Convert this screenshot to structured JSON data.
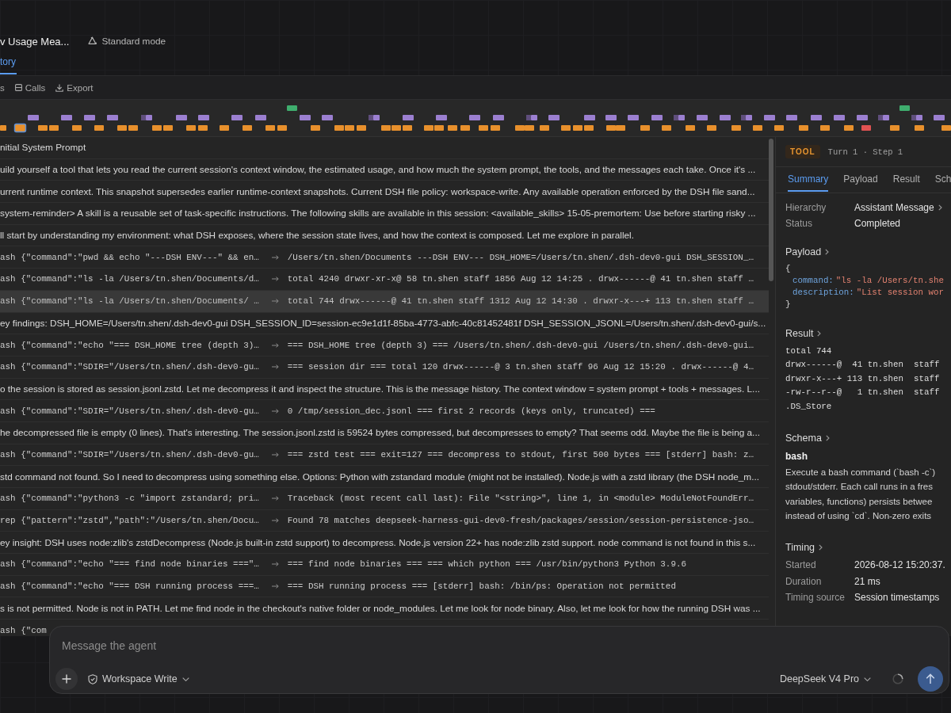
{
  "header": {
    "title": "v Usage Mea...",
    "mode": "Standard mode",
    "tabs": [
      {
        "label": "tory",
        "selected": true
      }
    ]
  },
  "toolbar": {
    "item_1": "s",
    "calls_button": "Calls",
    "export_button": "Export"
  },
  "rows": [
    {
      "kind": "text",
      "text": "nitial System Prompt",
      "selected": false
    },
    {
      "kind": "text",
      "text": "uild yourself a tool that lets you read the current session's context window, the estimated usage, and how much the system prompt, the tools, and the messages each take. Once it's ...",
      "selected": false
    },
    {
      "kind": "text",
      "text": "urrent runtime context. This snapshot supersedes earlier runtime-context snapshots. Current DSH file policy: workspace-write. Any available operation enforced by the DSH file sand...",
      "selected": false
    },
    {
      "kind": "text",
      "text": "system-reminder> A skill is a reusable set of task-specific instructions. The following skills are available in this session: <available_skills> 15-05-premortem: Use before starting risky ...",
      "selected": false
    },
    {
      "kind": "text",
      "text": "ll start by understanding my environment: what DSH exposes, where the session state lives, and how the context is composed. Let me explore in parallel.",
      "selected": false
    },
    {
      "kind": "tool",
      "command": "ash {\"command\":\"pwd && echo \"---DSH ENV---\" && en…",
      "result": "/Users/tn.shen/Documents ---DSH ENV--- DSH_HOME=/Users/tn.shen/.dsh-dev0-gui DSH_SESSION_…",
      "selected": false
    },
    {
      "kind": "tool",
      "command": "ash {\"command\":\"ls -la /Users/tn.shen/Documents/d…",
      "result": "total 4240 drwxr-xr-x@ 58 tn.shen staff 1856 Aug 12 14:25 . drwx------@ 41 tn.shen staff …",
      "selected": false
    },
    {
      "kind": "tool",
      "command": "ash {\"command\":\"ls -la /Users/tn.shen/Documents/ …",
      "result": "total 744 drwx------@ 41 tn.shen staff 1312 Aug 12 14:30 . drwxr-x---+ 113 tn.shen staff …",
      "selected": true
    },
    {
      "kind": "text",
      "text": "ey findings: DSH_HOME=/Users/tn.shen/.dsh-dev0-gui DSH_SESSION_ID=session-ec9e1d1f-85ba-4773-abfc-40c81452481f DSH_SESSION_JSONL=/Users/tn.shen/.dsh-dev0-gui/s...",
      "selected": false
    },
    {
      "kind": "tool",
      "command": "ash {\"command\":\"echo \"=== DSH_HOME tree (depth 3)…",
      "result": "=== DSH_HOME tree (depth 3) === /Users/tn.shen/.dsh-dev0-gui /Users/tn.shen/.dsh-dev0-gui…",
      "selected": false
    },
    {
      "kind": "tool",
      "command": "ash {\"command\":\"SDIR=\"/Users/tn.shen/.dsh-dev0-gu…",
      "result": "=== session dir === total 120 drwx------@ 3 tn.shen staff 96 Aug 12 15:20 . drwx------@ 4…",
      "selected": false
    },
    {
      "kind": "text",
      "text": "o the session is stored as session.jsonl.zstd. Let me decompress it and inspect the structure. This is the message history. The context window = system prompt + tools + messages. L...",
      "selected": false
    },
    {
      "kind": "tool",
      "command": "ash {\"command\":\"SDIR=\"/Users/tn.shen/.dsh-dev0-gu…",
      "result": "0 /tmp/session_dec.jsonl === first 2 records (keys only, truncated) ===",
      "selected": false
    },
    {
      "kind": "text",
      "text": "he decompressed file is empty (0 lines). That's interesting. The session.jsonl.zstd is 59524 bytes compressed, but decompresses to empty? That seems odd. Maybe the file is being a...",
      "selected": false
    },
    {
      "kind": "tool",
      "command": "ash {\"command\":\"SDIR=\"/Users/tn.shen/.dsh-dev0-gu…",
      "result": "=== zstd test === exit=127 === decompress to stdout, first 500 bytes === [stderr] bash: z…",
      "selected": false
    },
    {
      "kind": "text",
      "text": "std command not found. So I need to decompress using something else. Options: Python with zstandard module (might not be installed). Node.js with a zstd library (the DSH node_m...",
      "selected": false
    },
    {
      "kind": "tool",
      "command": "ash {\"command\":\"python3 -c \"import zstandard; pri…",
      "result": "Traceback (most recent call last): File \"<string>\", line 1, in <module> ModuleNotFoundErr…",
      "selected": false
    },
    {
      "kind": "tool",
      "command": "rep {\"pattern\":\"zstd\",\"path\":\"/Users/tn.shen/Docu…",
      "result": "Found 78 matches deepseek-harness-gui-dev0-fresh/packages/session/session-persistence-jso…",
      "selected": false
    },
    {
      "kind": "text",
      "text": "ey insight: DSH uses node:zlib's zstdDecompress (Node.js built-in zstd support) to decompress. Node.js version 22+ has node:zlib zstd support. node command is not found in this s...",
      "selected": false
    },
    {
      "kind": "tool",
      "command": "ash {\"command\":\"echo \"=== find node binaries ===\"…",
      "result": "=== find node binaries === === which python === /usr/bin/python3 Python 3.9.6",
      "selected": false
    },
    {
      "kind": "tool",
      "command": "ash {\"command\":\"echo \"=== DSH running process ===…",
      "result": "=== DSH running process === [stderr] bash: /bin/ps: Operation not permitted",
      "selected": false
    },
    {
      "kind": "text",
      "text": "s is not permitted. Node is not in PATH. Let me find node in the checkout's native folder or node_modules. Let me look for node binary. Also, let me look for how the running DSH was ...",
      "selected": false
    },
    {
      "kind": "tool",
      "command": "ash {\"com",
      "selected": false
    }
  ],
  "detail": {
    "badge": "TOOL",
    "step": "Turn 1 · Step 1",
    "tabs": [
      {
        "label": "Summary",
        "selected": true
      },
      {
        "label": "Payload",
        "selected": false
      },
      {
        "label": "Result",
        "selected": false
      },
      {
        "label": "Sch",
        "selected": false
      }
    ],
    "fields": [
      {
        "label": "Hierarchy",
        "value": "Assistant Message",
        "link": true
      },
      {
        "label": "Status",
        "value": "Completed",
        "link": false
      }
    ],
    "payload": {
      "title": "Payload",
      "open": "{",
      "entries": [
        {
          "key": "command:",
          "value": "\"ls -la /Users/tn.she"
        },
        {
          "key": "description:",
          "value": "\"List session wor"
        }
      ],
      "close": "}"
    },
    "result": {
      "title": "Result",
      "lines": [
        "total 744",
        "drwx------@  41 tn.shen  staff",
        "drwxr-x---+ 113 tn.shen  staff",
        "-rw-r--r--@   1 tn.shen  staff",
        ".DS_Store"
      ]
    },
    "schema": {
      "title": "Schema",
      "name": "bash",
      "description_lines": [
        "Execute a bash command (`bash -c`)",
        "stdout/stderr. Each call runs in a fres",
        "variables, functions) persists betwee",
        "instead of using `cd`. Non-zero exits"
      ]
    },
    "timing": {
      "title": "Timing",
      "fields": [
        {
          "label": "Started",
          "value": "2026-08-12 15:20:37."
        },
        {
          "label": "Duration",
          "value": "21 ms"
        },
        {
          "label": "Timing source",
          "value": "Session timestamps"
        }
      ]
    }
  },
  "composer": {
    "placeholder": "Message the agent",
    "permission": "Workspace Write",
    "model": "DeepSeek V4 Pro"
  }
}
